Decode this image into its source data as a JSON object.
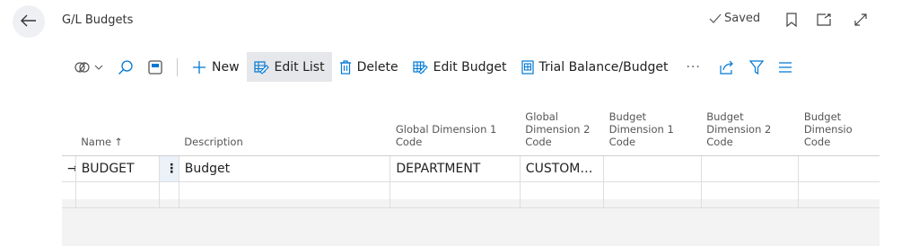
{
  "header": {
    "title": "G/L Budgets",
    "status": "Saved"
  },
  "toolbar": {
    "new_label": "New",
    "edit_list_label": "Edit List",
    "delete_label": "Delete",
    "edit_budget_label": "Edit Budget",
    "trial_balance_label": "Trial Balance/Budget",
    "more_label": "···"
  },
  "table": {
    "columns": {
      "name": "Name",
      "name_sort": "↑",
      "description": "Description",
      "global_dim1": [
        "Global Dimension 1",
        "Code"
      ],
      "global_dim2": [
        "Global",
        "Dimension 2",
        "Code"
      ],
      "budget_dim1": [
        "Budget",
        "Dimension 1",
        "Code"
      ],
      "budget_dim2": [
        "Budget",
        "Dimension 2",
        "Code"
      ],
      "budget_dim3": [
        "Budget",
        "Dimensio",
        "Code"
      ]
    },
    "rows": [
      {
        "row_indicator": "→",
        "name": "BUDGET",
        "row_menu": "⋮",
        "description": "Budget",
        "global_dim1": "DEPARTMENT",
        "global_dim2": "CUSTOME...",
        "budget_dim1": "",
        "budget_dim2": "",
        "budget_dim3": ""
      },
      {
        "row_indicator": "",
        "name": "",
        "row_menu": "",
        "description": "",
        "global_dim1": "",
        "global_dim2": "",
        "budget_dim1": "",
        "budget_dim2": "",
        "budget_dim3": ""
      }
    ]
  },
  "icons": {
    "back": "back-arrow-icon",
    "saved": "checkmark-icon",
    "bookmark": "bookmark-icon",
    "open_new_window": "open-in-new-window-icon",
    "expand": "expand-icon",
    "analysis": "analysis-mode-icon",
    "search": "search-icon",
    "view_layout": "view-layout-icon",
    "new": "plus-icon",
    "edit_list": "edit-list-icon",
    "delete": "trash-icon",
    "edit_budget": "edit-budget-icon",
    "trial_balance": "report-icon",
    "share": "share-icon",
    "filter": "filter-icon",
    "list_view": "list-view-icon"
  },
  "colors": {
    "accent": "#0078d4",
    "active_tool_bg": "#e6e7ea",
    "selected_row_menu_bg": "#eaf1f8",
    "footer_bg": "#f3f3f3"
  }
}
